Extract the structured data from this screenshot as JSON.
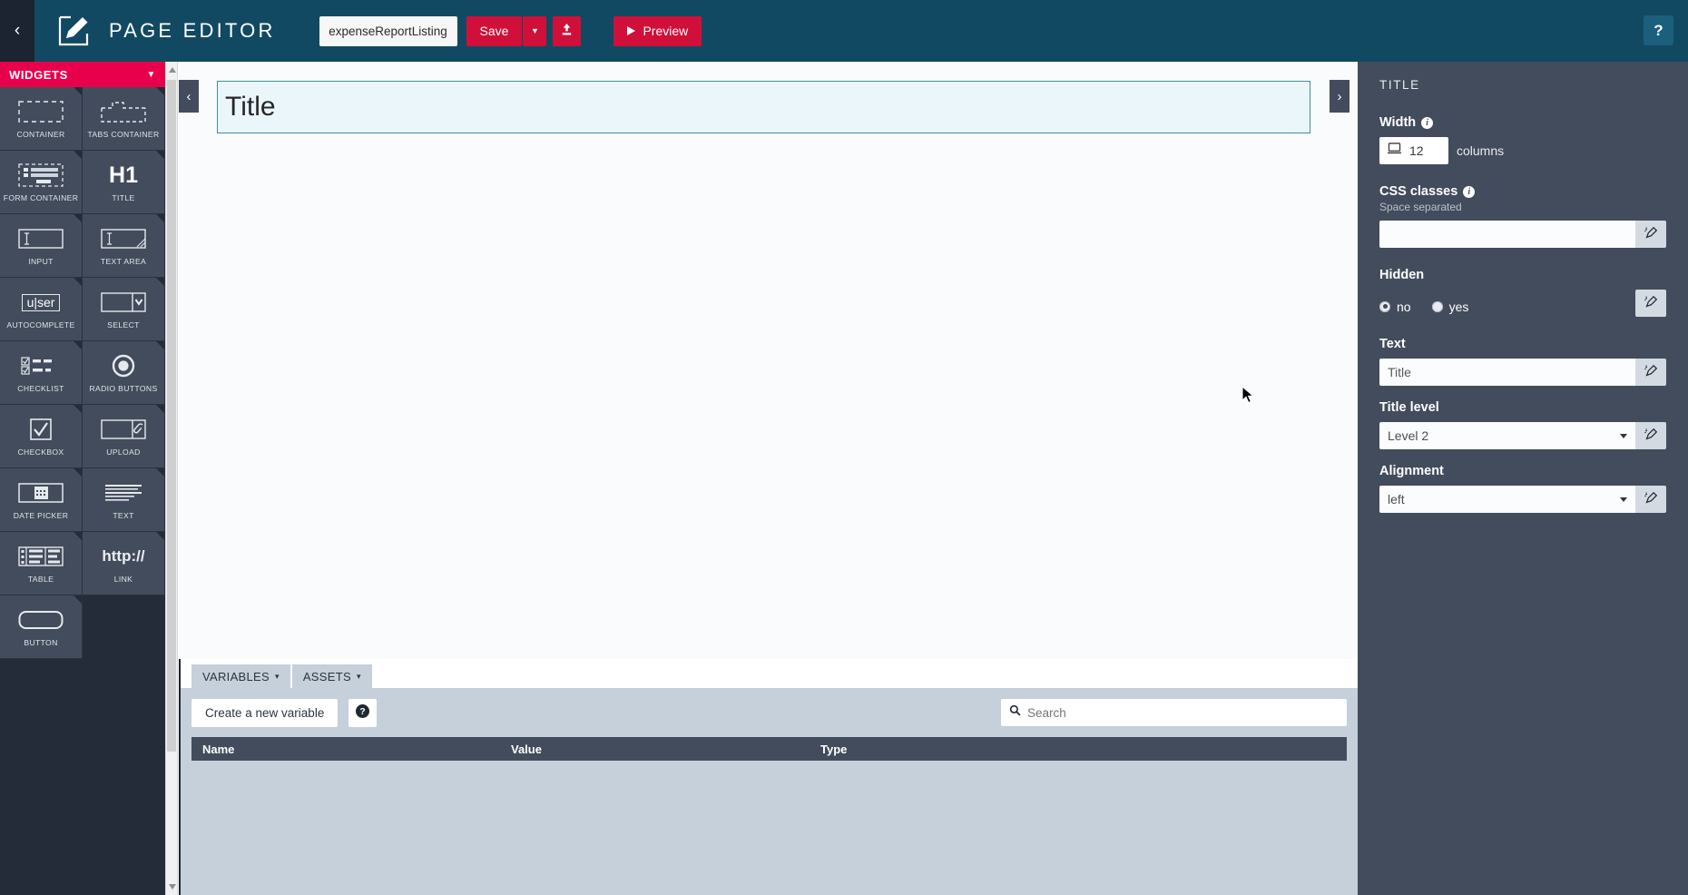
{
  "topbar": {
    "collapse_icon": "chevron-left-icon",
    "logo_icon": "pencil-square-icon",
    "title": "PAGE EDITOR",
    "page_name_value": "expenseReportListing",
    "save_label": "Save",
    "save_caret_icon": "caret-down-icon",
    "upload_icon": "upload-icon",
    "preview_label": "Preview",
    "preview_icon": "play-icon",
    "help_label": "?"
  },
  "left_panel": {
    "header": "WIDGETS",
    "header_caret_icon": "chevron-down-icon",
    "widgets": [
      {
        "label": "CONTAINER",
        "icon": "dashed-rectangle-icon"
      },
      {
        "label": "TABS CONTAINER",
        "icon": "tabs-container-icon"
      },
      {
        "label": "FORM CONTAINER",
        "icon": "form-container-icon"
      },
      {
        "label": "TITLE",
        "icon": "h1-icon"
      },
      {
        "label": "INPUT",
        "icon": "text-input-icon"
      },
      {
        "label": "TEXT AREA",
        "icon": "textarea-icon"
      },
      {
        "label": "AUTOCOMPLETE",
        "icon": "autocomplete-icon"
      },
      {
        "label": "SELECT",
        "icon": "select-dropdown-icon"
      },
      {
        "label": "CHECKLIST",
        "icon": "checklist-icon"
      },
      {
        "label": "RADIO BUTTONS",
        "icon": "radio-button-icon"
      },
      {
        "label": "CHECKBOX",
        "icon": "checkbox-icon"
      },
      {
        "label": "UPLOAD",
        "icon": "upload-field-icon"
      },
      {
        "label": "DATE PICKER",
        "icon": "calendar-icon"
      },
      {
        "label": "TEXT",
        "icon": "text-lines-icon"
      },
      {
        "label": "TABLE",
        "icon": "table-icon"
      },
      {
        "label": "LINK",
        "icon": "http-link-icon"
      },
      {
        "label": "BUTTON",
        "icon": "rounded-button-icon"
      }
    ]
  },
  "canvas": {
    "collapse_left_icon": "chevron-left-icon",
    "collapse_right_icon": "chevron-right-icon",
    "title_widget_text": "Title"
  },
  "bottom_panel": {
    "tabs": [
      {
        "label": "VARIABLES",
        "caret_icon": "chevron-down-icon",
        "active": true
      },
      {
        "label": "ASSETS",
        "caret_icon": "chevron-down-icon",
        "active": false
      }
    ],
    "create_variable_label": "Create a new variable",
    "help_label": "?",
    "search_placeholder": "Search",
    "search_icon": "search-icon",
    "table_headers": {
      "name": "Name",
      "value": "Value",
      "type": "Type"
    },
    "rows": []
  },
  "properties": {
    "panel_title": "TITLE",
    "width": {
      "label": "Width",
      "info_icon": "info-icon",
      "device_icon": "desktop-icon",
      "value": "12",
      "unit": "columns"
    },
    "css_classes": {
      "label": "CSS classes",
      "info_icon": "info-icon",
      "hint": "Space separated",
      "value": "",
      "bind_icon": "bind-variable-icon"
    },
    "hidden": {
      "label": "Hidden",
      "options": [
        {
          "label": "no",
          "checked": true
        },
        {
          "label": "yes",
          "checked": false
        }
      ],
      "bind_icon": "bind-variable-icon"
    },
    "text": {
      "label": "Text",
      "value": "Title",
      "bind_icon": "bind-variable-icon"
    },
    "title_level": {
      "label": "Title level",
      "value": "Level 2",
      "caret_icon": "caret-down-icon",
      "bind_icon": "bind-variable-icon"
    },
    "alignment": {
      "label": "Alignment",
      "value": "left",
      "caret_icon": "caret-down-icon",
      "bind_icon": "bind-variable-icon"
    }
  },
  "colors": {
    "topbar_bg": "#124962",
    "accent_red": "#d0103a",
    "widgets_header": "#e8004c",
    "panel_bg": "#434c5c",
    "sidebar_bg": "#242c3a",
    "bottom_bg": "#c6d0da",
    "widget_selected_border": "#3f8ea0"
  }
}
